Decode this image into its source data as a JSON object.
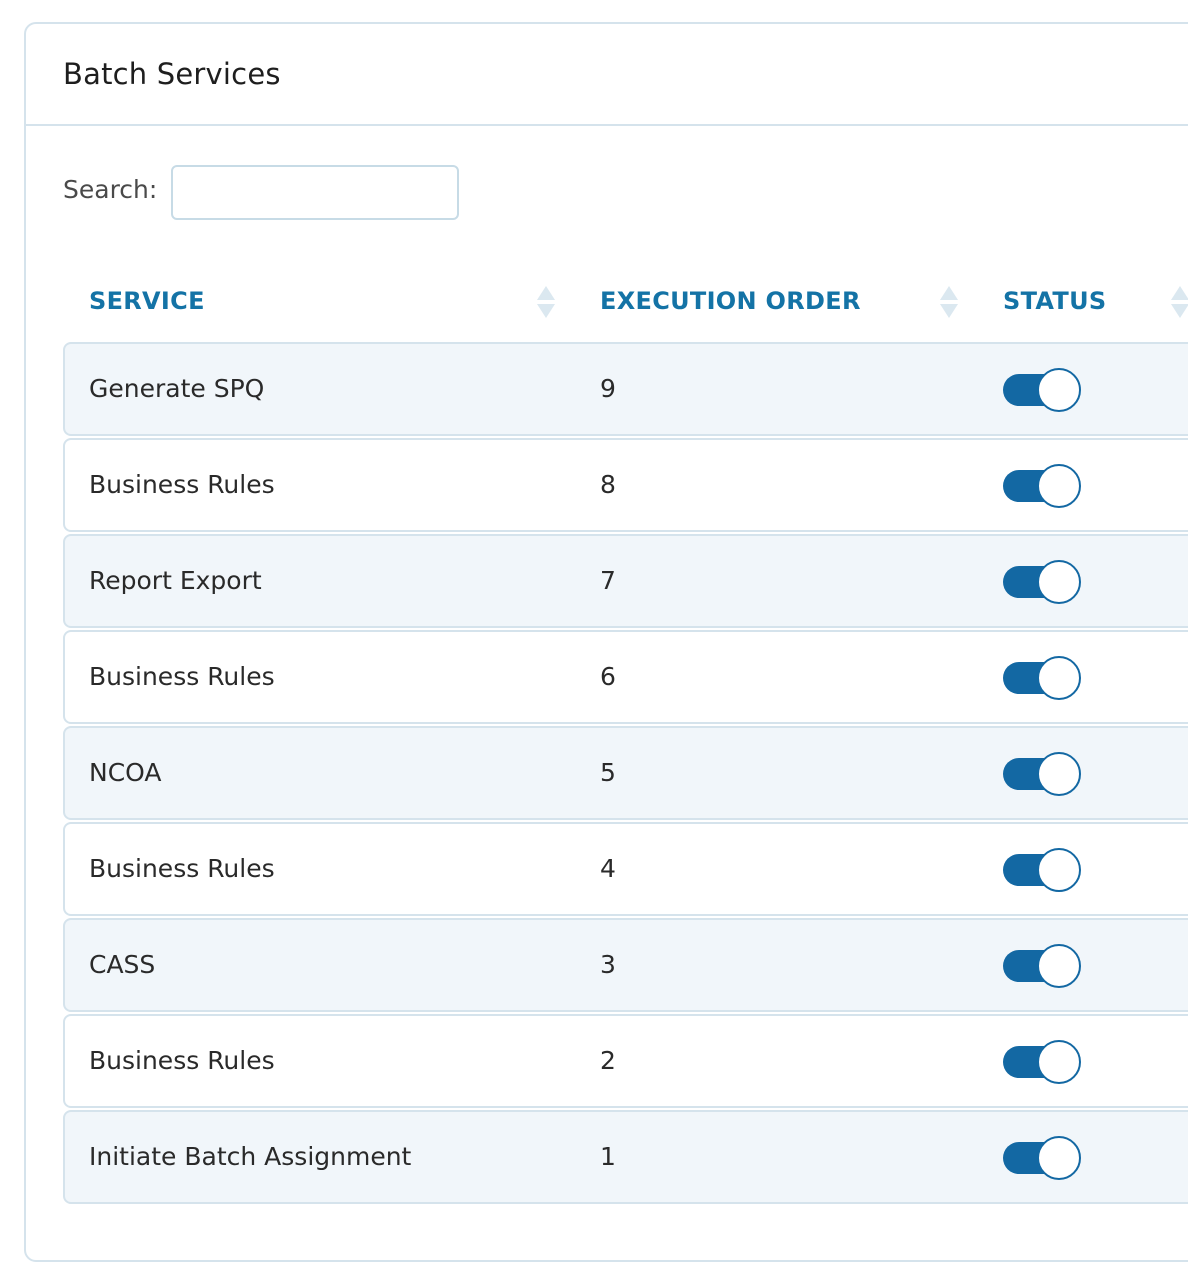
{
  "card": {
    "title": "Batch Services"
  },
  "search": {
    "label": "Search:",
    "value": "",
    "placeholder": ""
  },
  "table": {
    "columns": {
      "service": "SERVICE",
      "execution_order": "EXECUTION ORDER",
      "status": "STATUS"
    },
    "rows": [
      {
        "service": "Generate SPQ",
        "execution_order": "9",
        "status": "on"
      },
      {
        "service": "Business Rules",
        "execution_order": "8",
        "status": "on"
      },
      {
        "service": "Report Export",
        "execution_order": "7",
        "status": "on"
      },
      {
        "service": "Business Rules",
        "execution_order": "6",
        "status": "on"
      },
      {
        "service": "NCOA",
        "execution_order": "5",
        "status": "on"
      },
      {
        "service": "Business Rules",
        "execution_order": "4",
        "status": "on"
      },
      {
        "service": "CASS",
        "execution_order": "3",
        "status": "on"
      },
      {
        "service": "Business Rules",
        "execution_order": "2",
        "status": "on"
      },
      {
        "service": "Initiate Batch Assignment",
        "execution_order": "1",
        "status": "on"
      }
    ]
  },
  "colors": {
    "accent": "#1473a6",
    "toggle_on": "#1368a3",
    "row_alt": "#f1f6fa",
    "border": "#d5e3ec"
  },
  "icons": {
    "sort": "sort-icon"
  }
}
